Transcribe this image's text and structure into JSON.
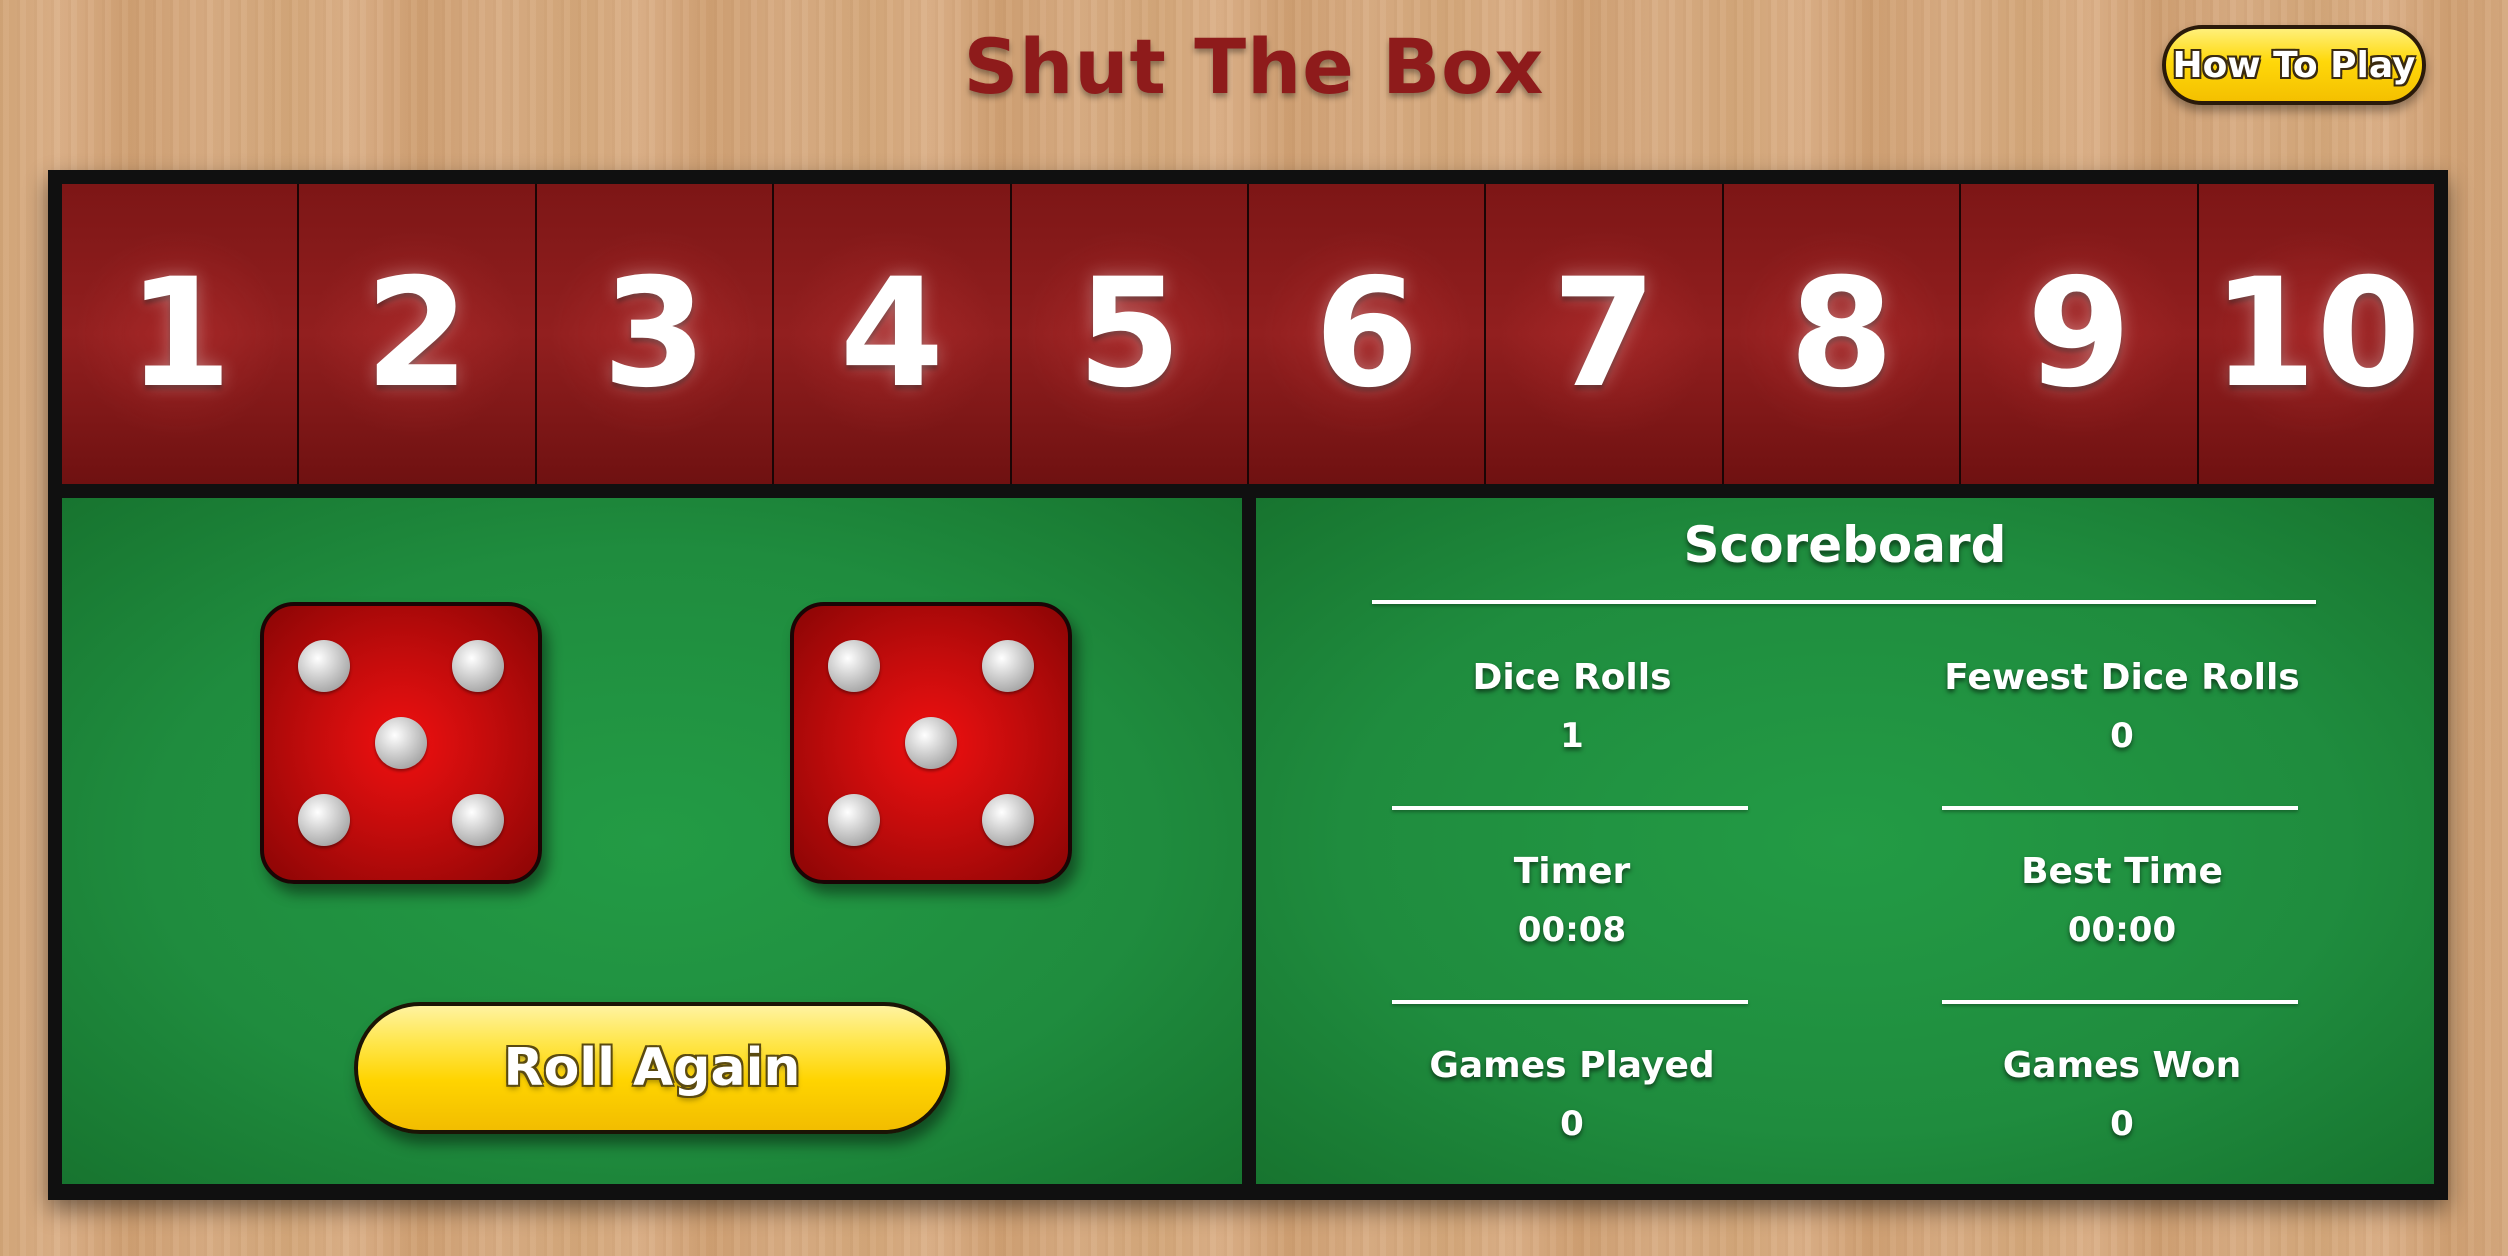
{
  "header": {
    "title": "Shut The Box",
    "how_to_play_label": "How To Play"
  },
  "tiles": [
    "1",
    "2",
    "3",
    "4",
    "5",
    "6",
    "7",
    "8",
    "9",
    "10"
  ],
  "dice": [
    {
      "value": 5,
      "color": "#d10e0e"
    },
    {
      "value": 5,
      "color": "#d10e0e"
    }
  ],
  "controls": {
    "roll_again_label": "Roll Again"
  },
  "scoreboard": {
    "title": "Scoreboard",
    "stats": {
      "dice_rolls": {
        "label": "Dice Rolls",
        "value": "1"
      },
      "fewest_dice_rolls": {
        "label": "Fewest Dice Rolls",
        "value": "0"
      },
      "timer": {
        "label": "Timer",
        "value": "00:08"
      },
      "best_time": {
        "label": "Best Time",
        "value": "00:00"
      },
      "games_played": {
        "label": "Games Played",
        "value": "0"
      },
      "games_won": {
        "label": "Games Won",
        "value": "0"
      }
    }
  },
  "colors": {
    "title_red": "#8e1b1b",
    "tile_red": "#8a1a1a",
    "felt_green": "#1f8c3e",
    "button_yellow": "#ffd400"
  }
}
